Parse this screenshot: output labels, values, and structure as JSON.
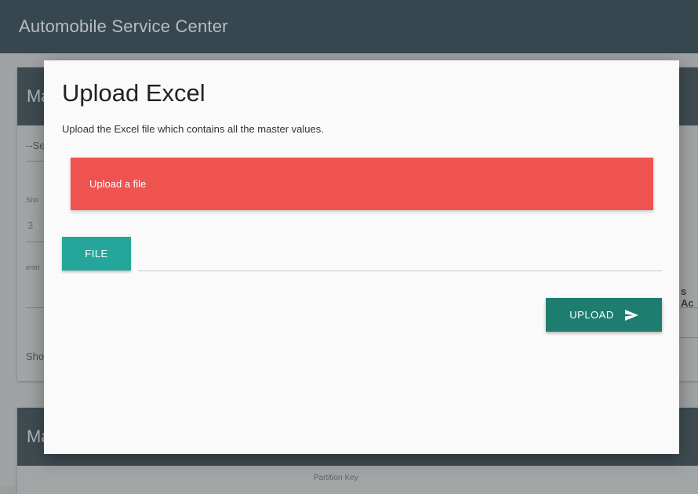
{
  "app": {
    "title": "Automobile Service Center"
  },
  "background": {
    "card1_heading_fragment": "Ma",
    "select_fragment": "--Se",
    "show_fragment": "Sho",
    "entries_value": "3",
    "entries_fragment": "entri",
    "right_fragment": "s Ac",
    "bottom_show_fragment": "Sho",
    "card2_heading_fragment": "Ma",
    "partition_label": "Partition Key"
  },
  "modal": {
    "title": "Upload Excel",
    "description": "Upload the Excel file which contains all the master values.",
    "alert_text": "Upload a file",
    "file_button_label": "FILE",
    "file_path_value": "",
    "upload_button_label": "UPLOAD",
    "upload_icon": "send-icon"
  },
  "colors": {
    "header": "#37474f",
    "alert": "#ef5350",
    "file_button": "#26a69a",
    "upload_button": "#1e7d6f"
  }
}
